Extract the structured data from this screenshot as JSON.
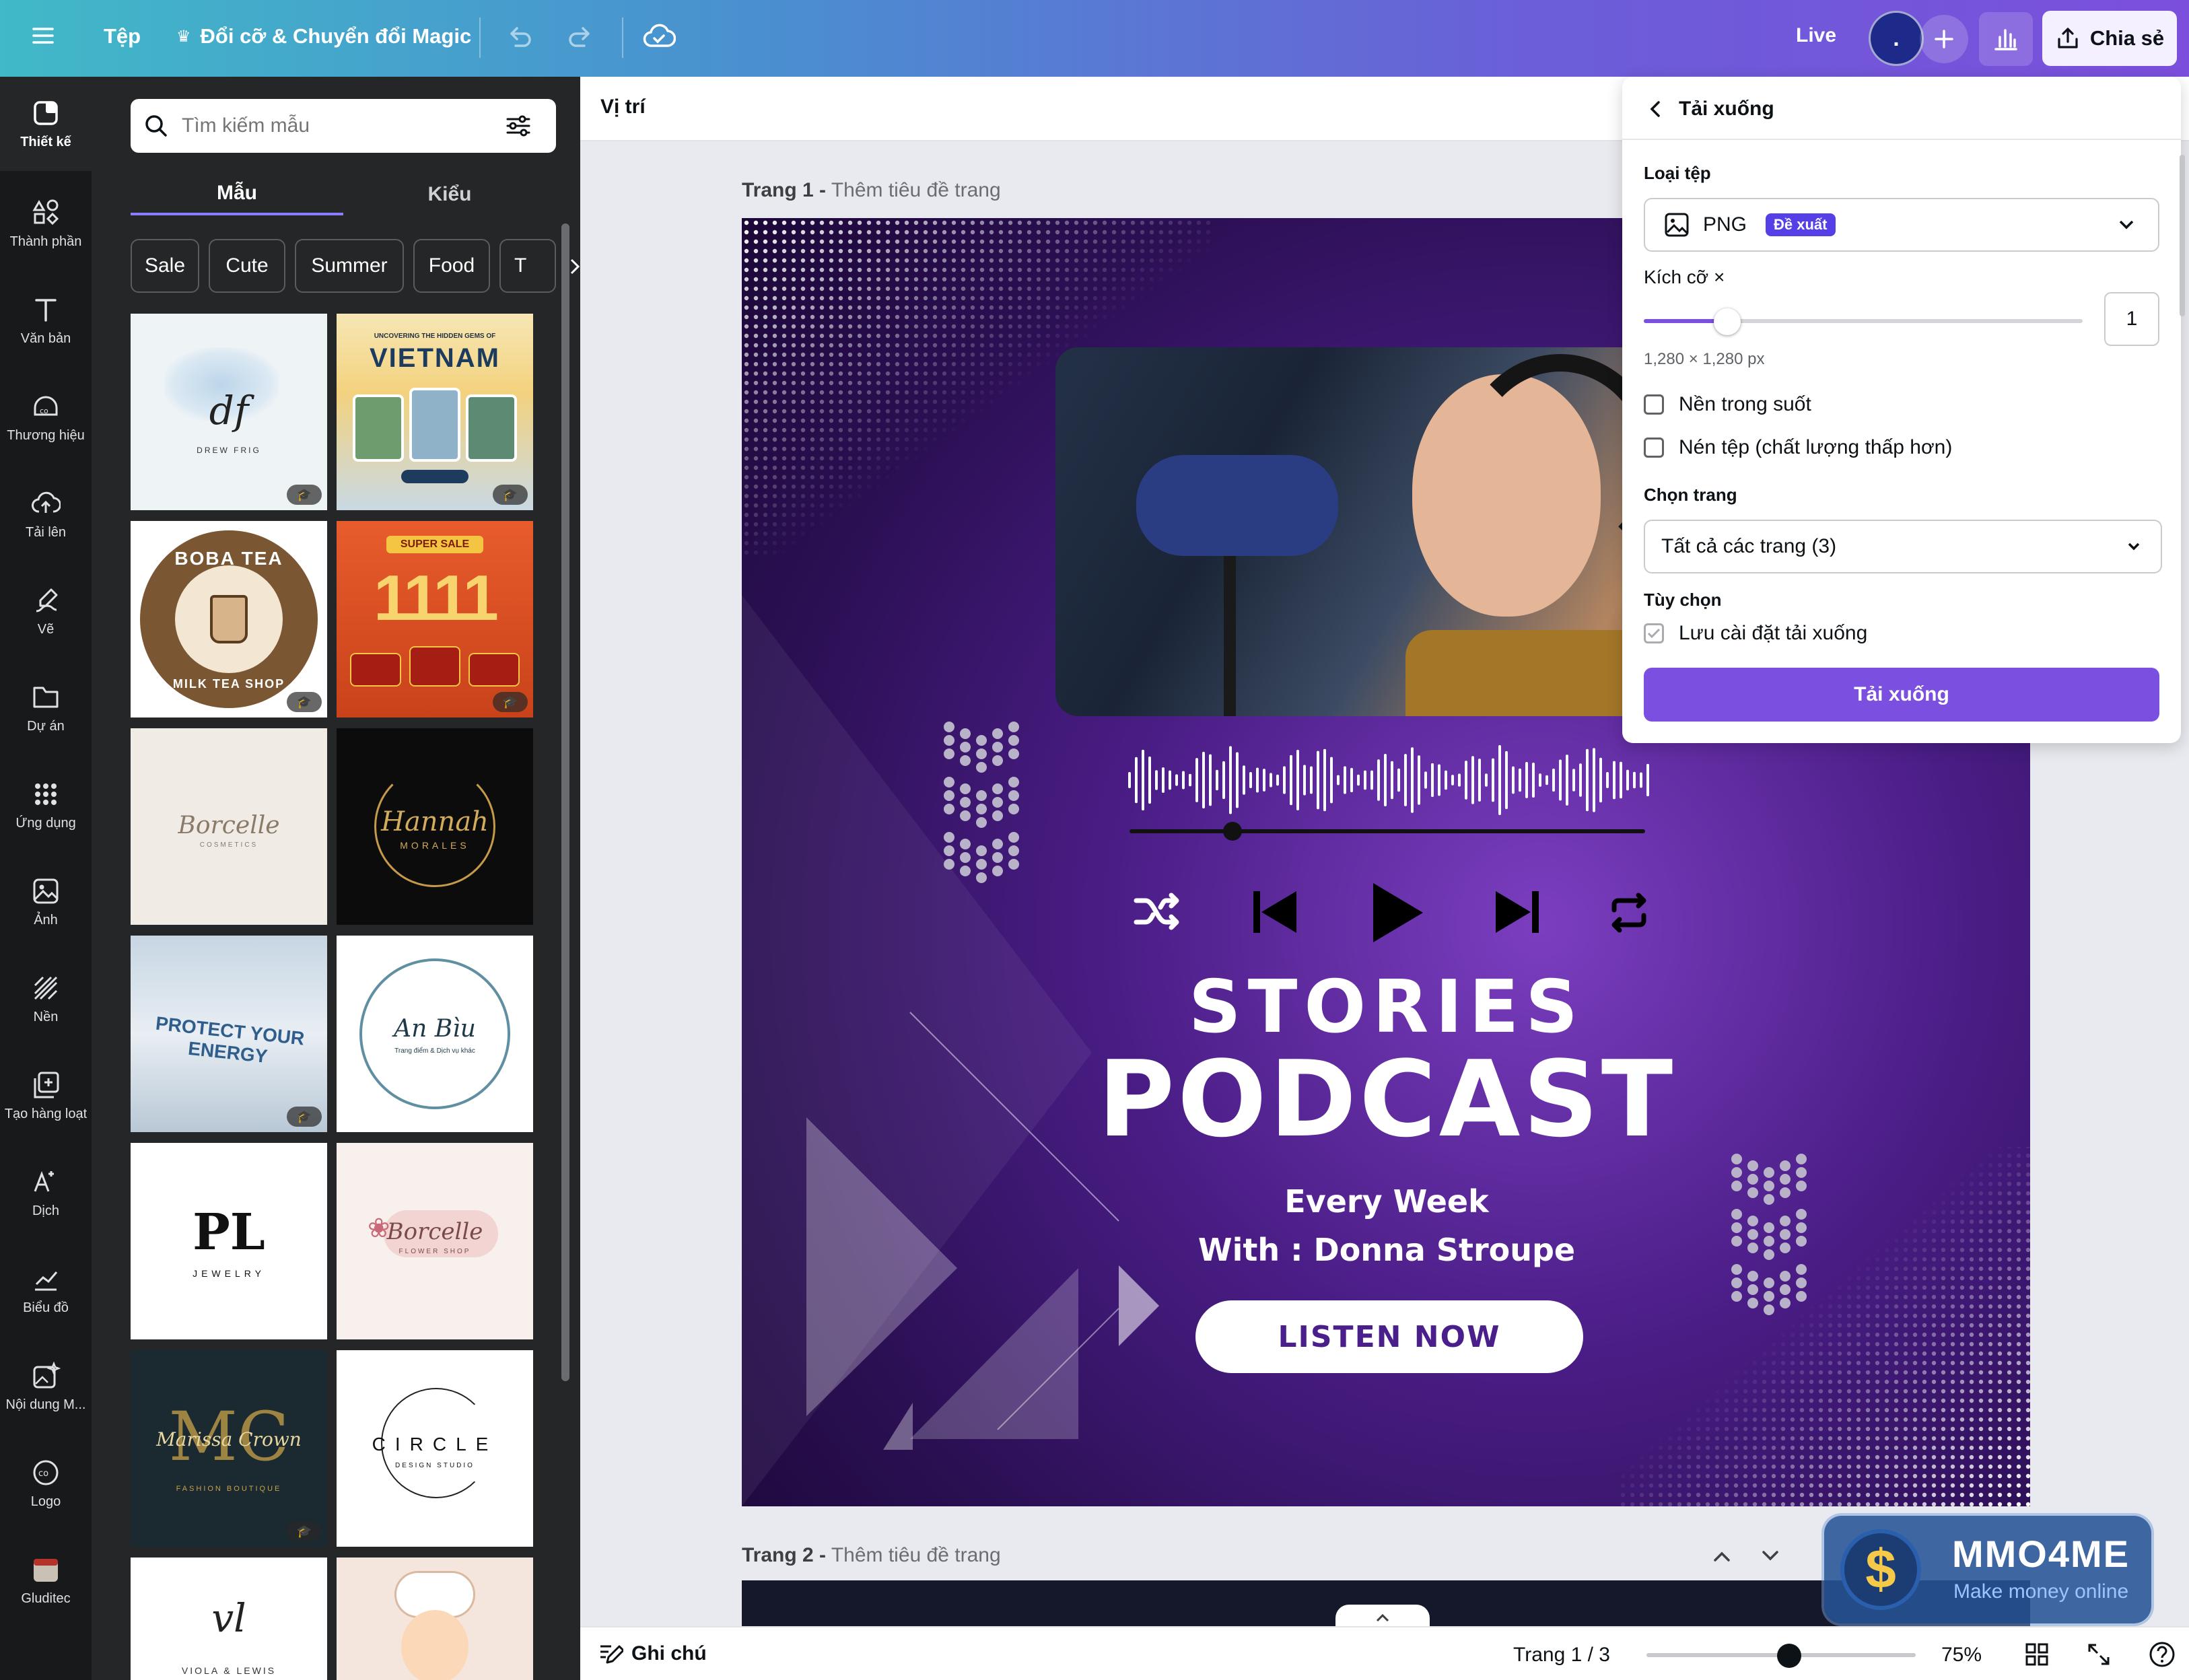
{
  "topbar": {
    "menu_label": "Tệp",
    "magic_label": "Đổi cỡ & Chuyển đổi Magic",
    "live_label": "Live",
    "avatar_label": ".",
    "share_label": "Chia sẻ"
  },
  "sidebar": {
    "items": [
      {
        "label": "Thiết kế",
        "icon": "design-icon"
      },
      {
        "label": "Thành phần",
        "icon": "elements-icon"
      },
      {
        "label": "Văn bản",
        "icon": "text-icon"
      },
      {
        "label": "Thương hiệu",
        "icon": "brand-icon"
      },
      {
        "label": "Tải lên",
        "icon": "upload-icon"
      },
      {
        "label": "Vẽ",
        "icon": "draw-icon"
      },
      {
        "label": "Dự án",
        "icon": "folder-icon"
      },
      {
        "label": "Ứng dụng",
        "icon": "apps-icon"
      },
      {
        "label": "Ảnh",
        "icon": "photo-icon"
      },
      {
        "label": "Nền",
        "icon": "background-icon"
      },
      {
        "label": "Tạo hàng loạt",
        "icon": "bulk-create-icon"
      },
      {
        "label": "Dịch",
        "icon": "translate-icon"
      },
      {
        "label": "Biểu đồ",
        "icon": "chart-icon"
      },
      {
        "label": "Nội dung M...",
        "icon": "magic-media-icon"
      },
      {
        "label": "Logo",
        "icon": "logo-icon"
      },
      {
        "label": "Gluditec",
        "icon": "gluditec-app-icon"
      }
    ]
  },
  "panel": {
    "search_placeholder": "Tìm kiếm mẫu",
    "tabs": [
      "Mẫu",
      "Kiểu"
    ],
    "chips": [
      "Sale",
      "Cute",
      "Summer",
      "Food",
      "T"
    ],
    "templates": [
      {
        "title": "DREW FRIG",
        "sub": "",
        "badge": true
      },
      {
        "title": "VIETNAM",
        "sub": "UNCOVERING THE HIDDEN GEMS OF",
        "badge": true
      },
      {
        "title": "BOBA TEA",
        "sub": "MILK TEA SHOP",
        "badge": true
      },
      {
        "title": "1111",
        "sub": "SUPER SALE",
        "badge": true
      },
      {
        "title": "Borcelle",
        "sub": "COSMETICS",
        "badge": false
      },
      {
        "title": "Hannah",
        "sub": "MORALES",
        "badge": false
      },
      {
        "title": "PROTECT YOUR ENERGY",
        "sub": "",
        "badge": true
      },
      {
        "title": "An Bìu",
        "sub": "Trang điểm & Dịch vụ khác",
        "badge": false
      },
      {
        "title": "PL",
        "sub": "JEWELRY",
        "badge": false
      },
      {
        "title": "Borcelle",
        "sub": "FLOWER SHOP",
        "badge": false
      },
      {
        "title": "Marissa Crown",
        "sub": "FASHION BOUTIQUE",
        "badge": true
      },
      {
        "title": "CIRCLE",
        "sub": "DESIGN STUDIO",
        "badge": false
      },
      {
        "title": "VIOLA & LEWIS",
        "sub": "",
        "badge": false
      },
      {
        "title": "",
        "sub": "",
        "badge": false
      }
    ]
  },
  "editor": {
    "position_label": "Vị trí",
    "page1_label": "Trang 1 -",
    "page1_title": "Thêm tiêu đề trang",
    "page2_label": "Trang 2 -",
    "page2_title": "Thêm tiêu đề trang"
  },
  "design": {
    "title1": "STORIES",
    "title2": "PODCAST",
    "line1": "Every Week",
    "line2": "With : Donna Stroupe",
    "cta": "LISTEN NOW",
    "player_progress": 0.2
  },
  "download": {
    "title": "Tải xuống",
    "file_type_label": "Loại tệp",
    "file_type_value": "PNG",
    "recommended_badge": "Đề xuất",
    "size_label": "Kích cỡ ×",
    "size_value": "1",
    "size_slider_fraction": 0.19,
    "dimensions": "1,280 × 1,280 px",
    "opt_transparent": "Nền trong suốt",
    "opt_compress": "Nén tệp (chất lượng thấp hơn)",
    "pages_label": "Chọn trang",
    "pages_value": "Tất cả các trang (3)",
    "options_label": "Tùy chọn",
    "opt_save": "Lưu cài đặt tải xuống",
    "button": "Tải xuống"
  },
  "bottombar": {
    "notes_label": "Ghi chú",
    "page_indicator": "Trang 1 / 3",
    "zoom": "75%",
    "zoom_fraction": 0.53
  },
  "watermark": {
    "brand": "MMO4ME",
    "tagline": "Make money online"
  },
  "colors": {
    "accent": "#7d2ae8",
    "button": "#7b4fe0",
    "badge": "#5540e8"
  }
}
